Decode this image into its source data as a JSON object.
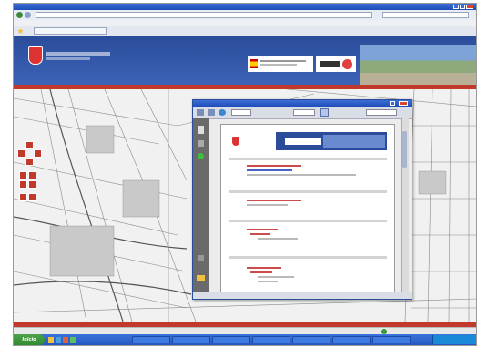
{
  "taskbar": {
    "start_label": "Inicio"
  },
  "colors": {
    "accent_red": "#c0392b",
    "header_blue": "#2a4c9a",
    "taskbar_blue": "#2457c0"
  },
  "icons": [
    "ie-logo-icon",
    "back-icon",
    "forward-icon",
    "star-icon",
    "close-icon",
    "minimize-icon",
    "maximize-icon",
    "zoom-in-icon",
    "zoom-out-icon",
    "pan-icon",
    "print-icon",
    "start-icon"
  ]
}
